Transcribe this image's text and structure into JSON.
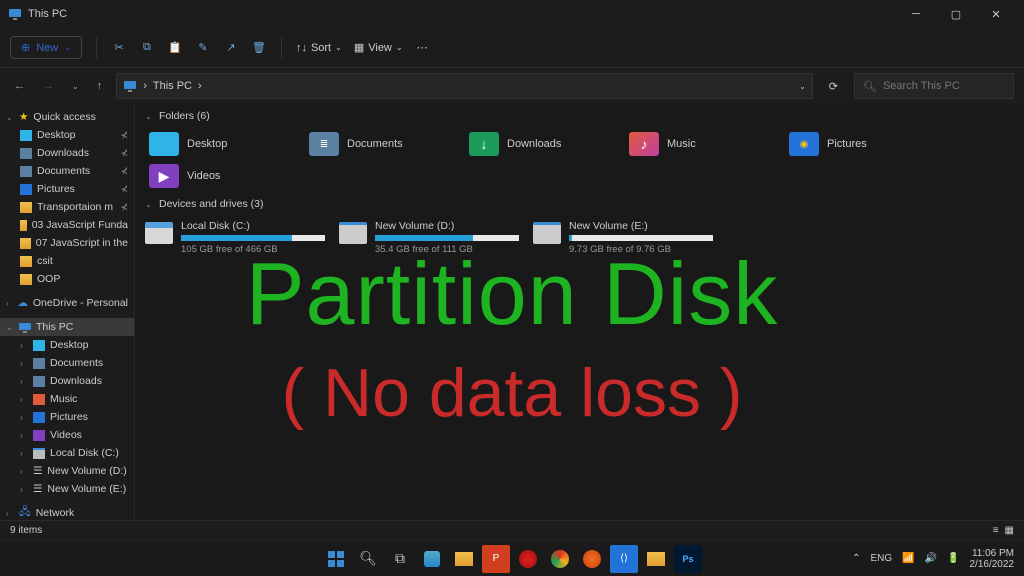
{
  "titlebar": {
    "title": "This PC"
  },
  "toolbar": {
    "new": "New",
    "sort": "Sort",
    "view": "View"
  },
  "breadcrumb": {
    "item": "This PC",
    "chevron": "›"
  },
  "search": {
    "placeholder": "Search This PC"
  },
  "sidebar": {
    "quick_access": "Quick access",
    "items_quick": [
      {
        "label": "Desktop",
        "icon": "desktop"
      },
      {
        "label": "Downloads",
        "icon": "downloads"
      },
      {
        "label": "Documents",
        "icon": "documents"
      },
      {
        "label": "Pictures",
        "icon": "pictures"
      },
      {
        "label": "Transportaion m",
        "icon": "folder"
      },
      {
        "label": "03 JavaScript Funda",
        "icon": "folder"
      },
      {
        "label": "07 JavaScript in the",
        "icon": "folder"
      },
      {
        "label": "csit",
        "icon": "folder"
      },
      {
        "label": "OOP",
        "icon": "folder"
      }
    ],
    "onedrive": "OneDrive - Personal",
    "this_pc": "This PC",
    "items_pc": [
      "Desktop",
      "Documents",
      "Downloads",
      "Music",
      "Pictures",
      "Videos",
      "Local Disk (C:)",
      "New Volume (D:)",
      "New Volume (E:)"
    ],
    "network": "Network"
  },
  "content": {
    "folders_header": "Folders (6)",
    "folders": [
      {
        "label": "Desktop",
        "color": "#2fb4e8"
      },
      {
        "label": "Documents",
        "color": "#5a7fa0"
      },
      {
        "label": "Downloads",
        "color": "#1a9b5a"
      },
      {
        "label": "Music",
        "color": "#e05a3c"
      },
      {
        "label": "Pictures",
        "color": "#2272d8"
      },
      {
        "label": "Videos",
        "color": "#8040c0"
      }
    ],
    "drives_header": "Devices and drives (3)",
    "drives": [
      {
        "name": "Local Disk (C:)",
        "status": "105 GB free of 466 GB",
        "fill": 77
      },
      {
        "name": "New Volume (D:)",
        "status": "35.4 GB free of 111 GB",
        "fill": 68
      },
      {
        "name": "New Volume (E:)",
        "status": "9.73 GB free of 9.76 GB",
        "fill": 2
      }
    ]
  },
  "overlay": {
    "line1": "Partition Disk",
    "line2": "( No data loss )"
  },
  "statusbar": {
    "items": "9 items"
  },
  "tray": {
    "lang": "ENG",
    "time": "11:06 PM",
    "date": "2/16/2022"
  }
}
